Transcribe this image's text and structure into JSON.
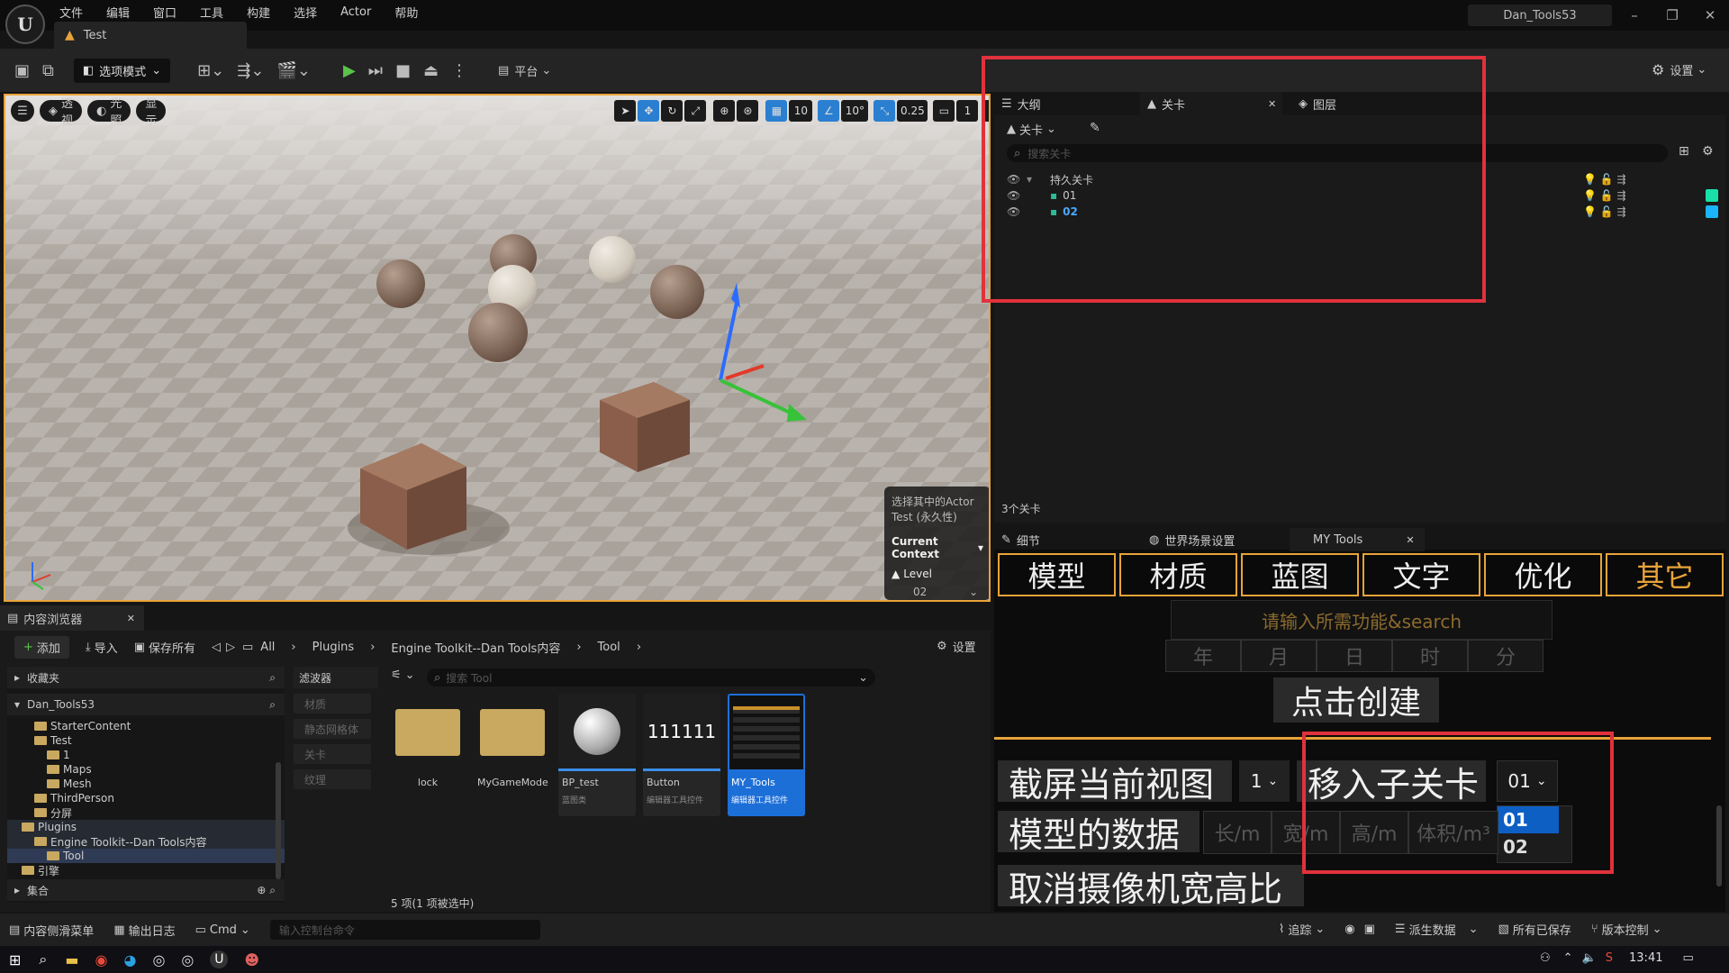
{
  "menubar": {
    "items": [
      "文件",
      "编辑",
      "窗口",
      "工具",
      "构建",
      "选择",
      "Actor",
      "帮助"
    ]
  },
  "project_title": "Dan_Tools53",
  "level_tab": "Test",
  "toolbar": {
    "mode": "选项模式",
    "platform": "平台",
    "settings": "设置"
  },
  "viewport": {
    "perspective": "透视",
    "lighting": "光照",
    "show": "显示",
    "grid_snap": "10",
    "angle_snap": "10°",
    "scale_snap": "0.25",
    "camera_speed": "1",
    "context": {
      "line1": "选择其中的Actor",
      "line2": "Test (永久性)",
      "current_context": "Current Context",
      "level_label": "Level",
      "level_value": "02"
    }
  },
  "outliner": {
    "tabs": [
      "大纲",
      "关卡",
      "图层"
    ],
    "levels_dropdown": "关卡",
    "search_placeholder": "搜索关卡",
    "levels": [
      {
        "name": "持久关卡",
        "color": ""
      },
      {
        "name": "01",
        "color": "#19e0a6"
      },
      {
        "name": "02",
        "color": "#1ab4ff"
      }
    ],
    "count": "3个关卡"
  },
  "details": {
    "tabs": [
      "细节",
      "世界场景设置",
      "MY Tools"
    ],
    "categories": [
      "模型",
      "材质",
      "蓝图",
      "文字",
      "优化",
      "其它"
    ],
    "search_text": "请输入所需功能&search",
    "date_fields": [
      "年",
      "月",
      "日",
      "时",
      "分"
    ],
    "create_button": "点击创建",
    "screenshot_button": "截屏当前视图",
    "screenshot_count": "1",
    "move_sublevel_button": "移入子关卡",
    "sublevel_selected": "01",
    "sublevel_options": [
      "01",
      "02"
    ],
    "model_data_button": "模型的数据",
    "dim_fields": [
      "长/m",
      "宽/m",
      "高/m",
      "体积/m³"
    ],
    "cancel_camera_button": "取消摄像机宽高比"
  },
  "content_browser": {
    "tab": "内容浏览器",
    "add": "添加",
    "import": "导入",
    "save_all": "保存所有",
    "breadcrumb": [
      "All",
      "Plugins",
      "Engine Toolkit--Dan Tools内容",
      "Tool"
    ],
    "settings": "设置",
    "favorites": "收藏夹",
    "root": "Dan_Tools53",
    "tree": [
      {
        "label": "StarterContent",
        "depth": 1
      },
      {
        "label": "Test",
        "depth": 1
      },
      {
        "label": "1",
        "depth": 2
      },
      {
        "label": "Maps",
        "depth": 2
      },
      {
        "label": "Mesh",
        "depth": 2
      },
      {
        "label": "ThirdPerson",
        "depth": 1
      },
      {
        "label": "分屏",
        "depth": 1
      },
      {
        "label": "Plugins",
        "depth": 0
      },
      {
        "label": "Engine Toolkit--Dan Tools内容",
        "depth": 1
      },
      {
        "label": "Tool",
        "depth": 2
      },
      {
        "label": "引擎",
        "depth": 0
      }
    ],
    "collections": "集合",
    "filters_title": "滤波器",
    "filters": [
      "材质",
      "静态网格体",
      "关卡",
      "纹理"
    ],
    "search_placeholder": "搜索 Tool",
    "assets": [
      {
        "name": "lock",
        "type": "",
        "kind": "folder"
      },
      {
        "name": "MyGameMode",
        "type": "",
        "kind": "folder"
      },
      {
        "name": "BP_test",
        "type": "蓝图类",
        "kind": "blueprint"
      },
      {
        "name": "Button",
        "type": "编辑器工具控件",
        "kind": "widget"
      },
      {
        "name": "MY_Tools",
        "type": "编辑器工具控件",
        "kind": "widget-selected"
      }
    ],
    "button_thumb_text": "111111",
    "status": "5 项(1 项被选中)"
  },
  "statusbar": {
    "drawer": "内容侧滑菜单",
    "output_log": "输出日志",
    "cmd": "Cmd",
    "console_placeholder": "输入控制台命令",
    "trace": "追踪",
    "derived_data": "派生数据",
    "saved": "所有已保存",
    "source_control": "版本控制"
  },
  "taskbar": {
    "time": "13:41"
  }
}
